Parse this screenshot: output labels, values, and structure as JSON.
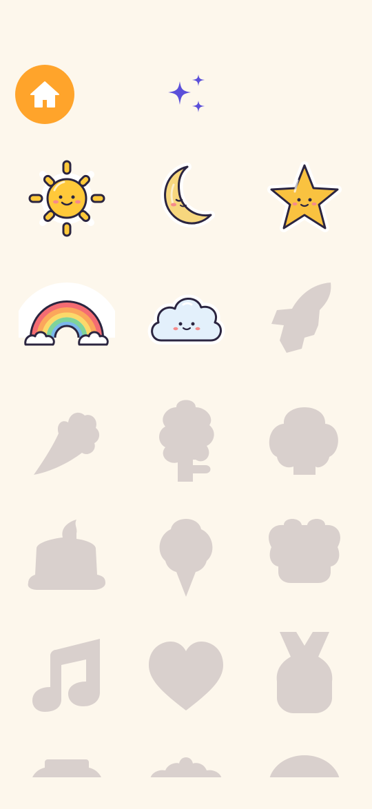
{
  "header": {
    "home_icon": "home-icon",
    "sparkle_icon": "sparkles-icon"
  },
  "colors": {
    "background": "#FDF7EC",
    "home_button": "#FFA42B",
    "sparkle": "#5B4FD9",
    "locked_sticker": "#D9D0CD"
  },
  "stickers": [
    {
      "name": "sun",
      "state": "unlocked"
    },
    {
      "name": "moon",
      "state": "unlocked"
    },
    {
      "name": "star",
      "state": "unlocked"
    },
    {
      "name": "rainbow",
      "state": "unlocked"
    },
    {
      "name": "cloud",
      "state": "unlocked"
    },
    {
      "name": "rocket",
      "state": "locked"
    },
    {
      "name": "bouquet",
      "state": "locked"
    },
    {
      "name": "flower",
      "state": "locked"
    },
    {
      "name": "tree",
      "state": "locked"
    },
    {
      "name": "cake",
      "state": "locked"
    },
    {
      "name": "ice-cream",
      "state": "locked"
    },
    {
      "name": "paw",
      "state": "locked"
    },
    {
      "name": "music-note",
      "state": "locked"
    },
    {
      "name": "heart",
      "state": "locked"
    },
    {
      "name": "medal",
      "state": "locked"
    },
    {
      "name": "sticker-row6-a",
      "state": "locked"
    },
    {
      "name": "sticker-row6-b",
      "state": "locked"
    },
    {
      "name": "sticker-row6-c",
      "state": "locked"
    }
  ]
}
